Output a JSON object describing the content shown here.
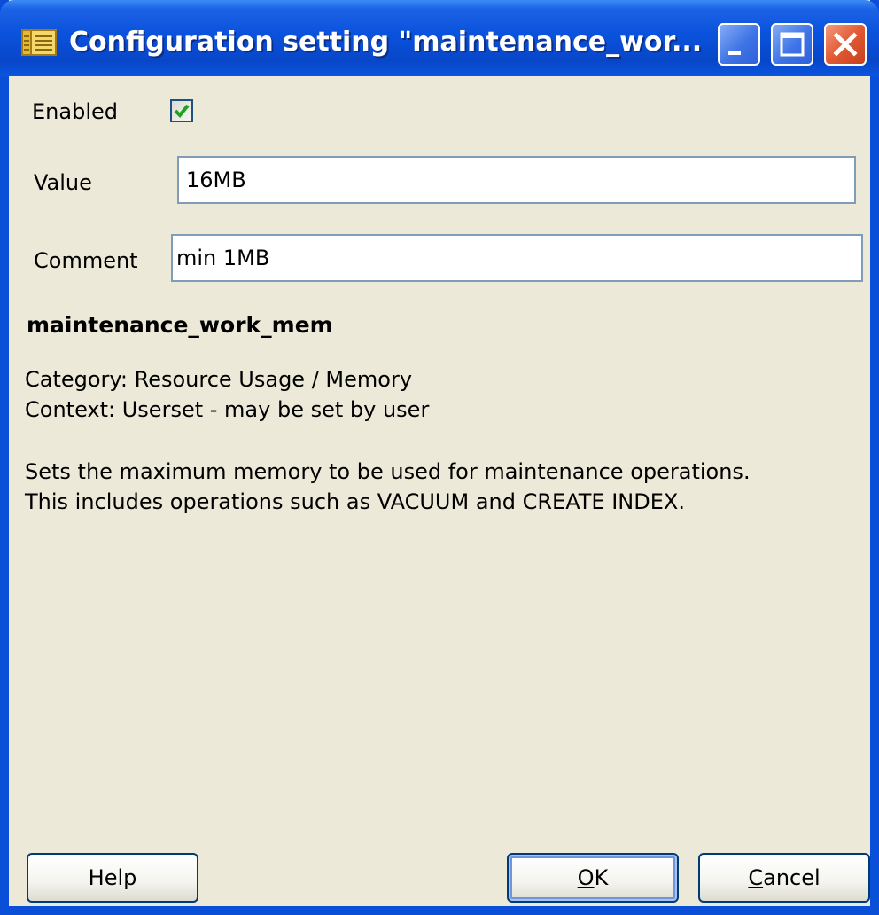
{
  "window": {
    "title": "Configuration setting \"maintenance_wor..."
  },
  "titlebar_buttons": {
    "minimize_icon": "minimize-icon",
    "maximize_icon": "maximize-icon",
    "close_icon": "close-icon"
  },
  "form": {
    "enabled_label": "Enabled",
    "enabled_checked": true,
    "value_label": "Value",
    "value_input": "16MB",
    "comment_label": "Comment",
    "comment_input": "min 1MB"
  },
  "details": {
    "setting_name": "maintenance_work_mem",
    "category": "Category: Resource Usage / Memory",
    "context": "Context: Userset - may be set by user",
    "description_line1": "Sets the maximum memory to be used for maintenance operations.",
    "description_line2": "This includes operations such as VACUUM and CREATE INDEX."
  },
  "buttons": {
    "help": "Help",
    "ok_mnemonic": "O",
    "ok_rest": "K",
    "cancel_mnemonic": "C",
    "cancel_rest": "ancel"
  },
  "colors": {
    "titlebar": "#0a52dc",
    "dialog_bg": "#ece9d8",
    "close_button": "#e25a33",
    "checkmark": "#21a121"
  }
}
